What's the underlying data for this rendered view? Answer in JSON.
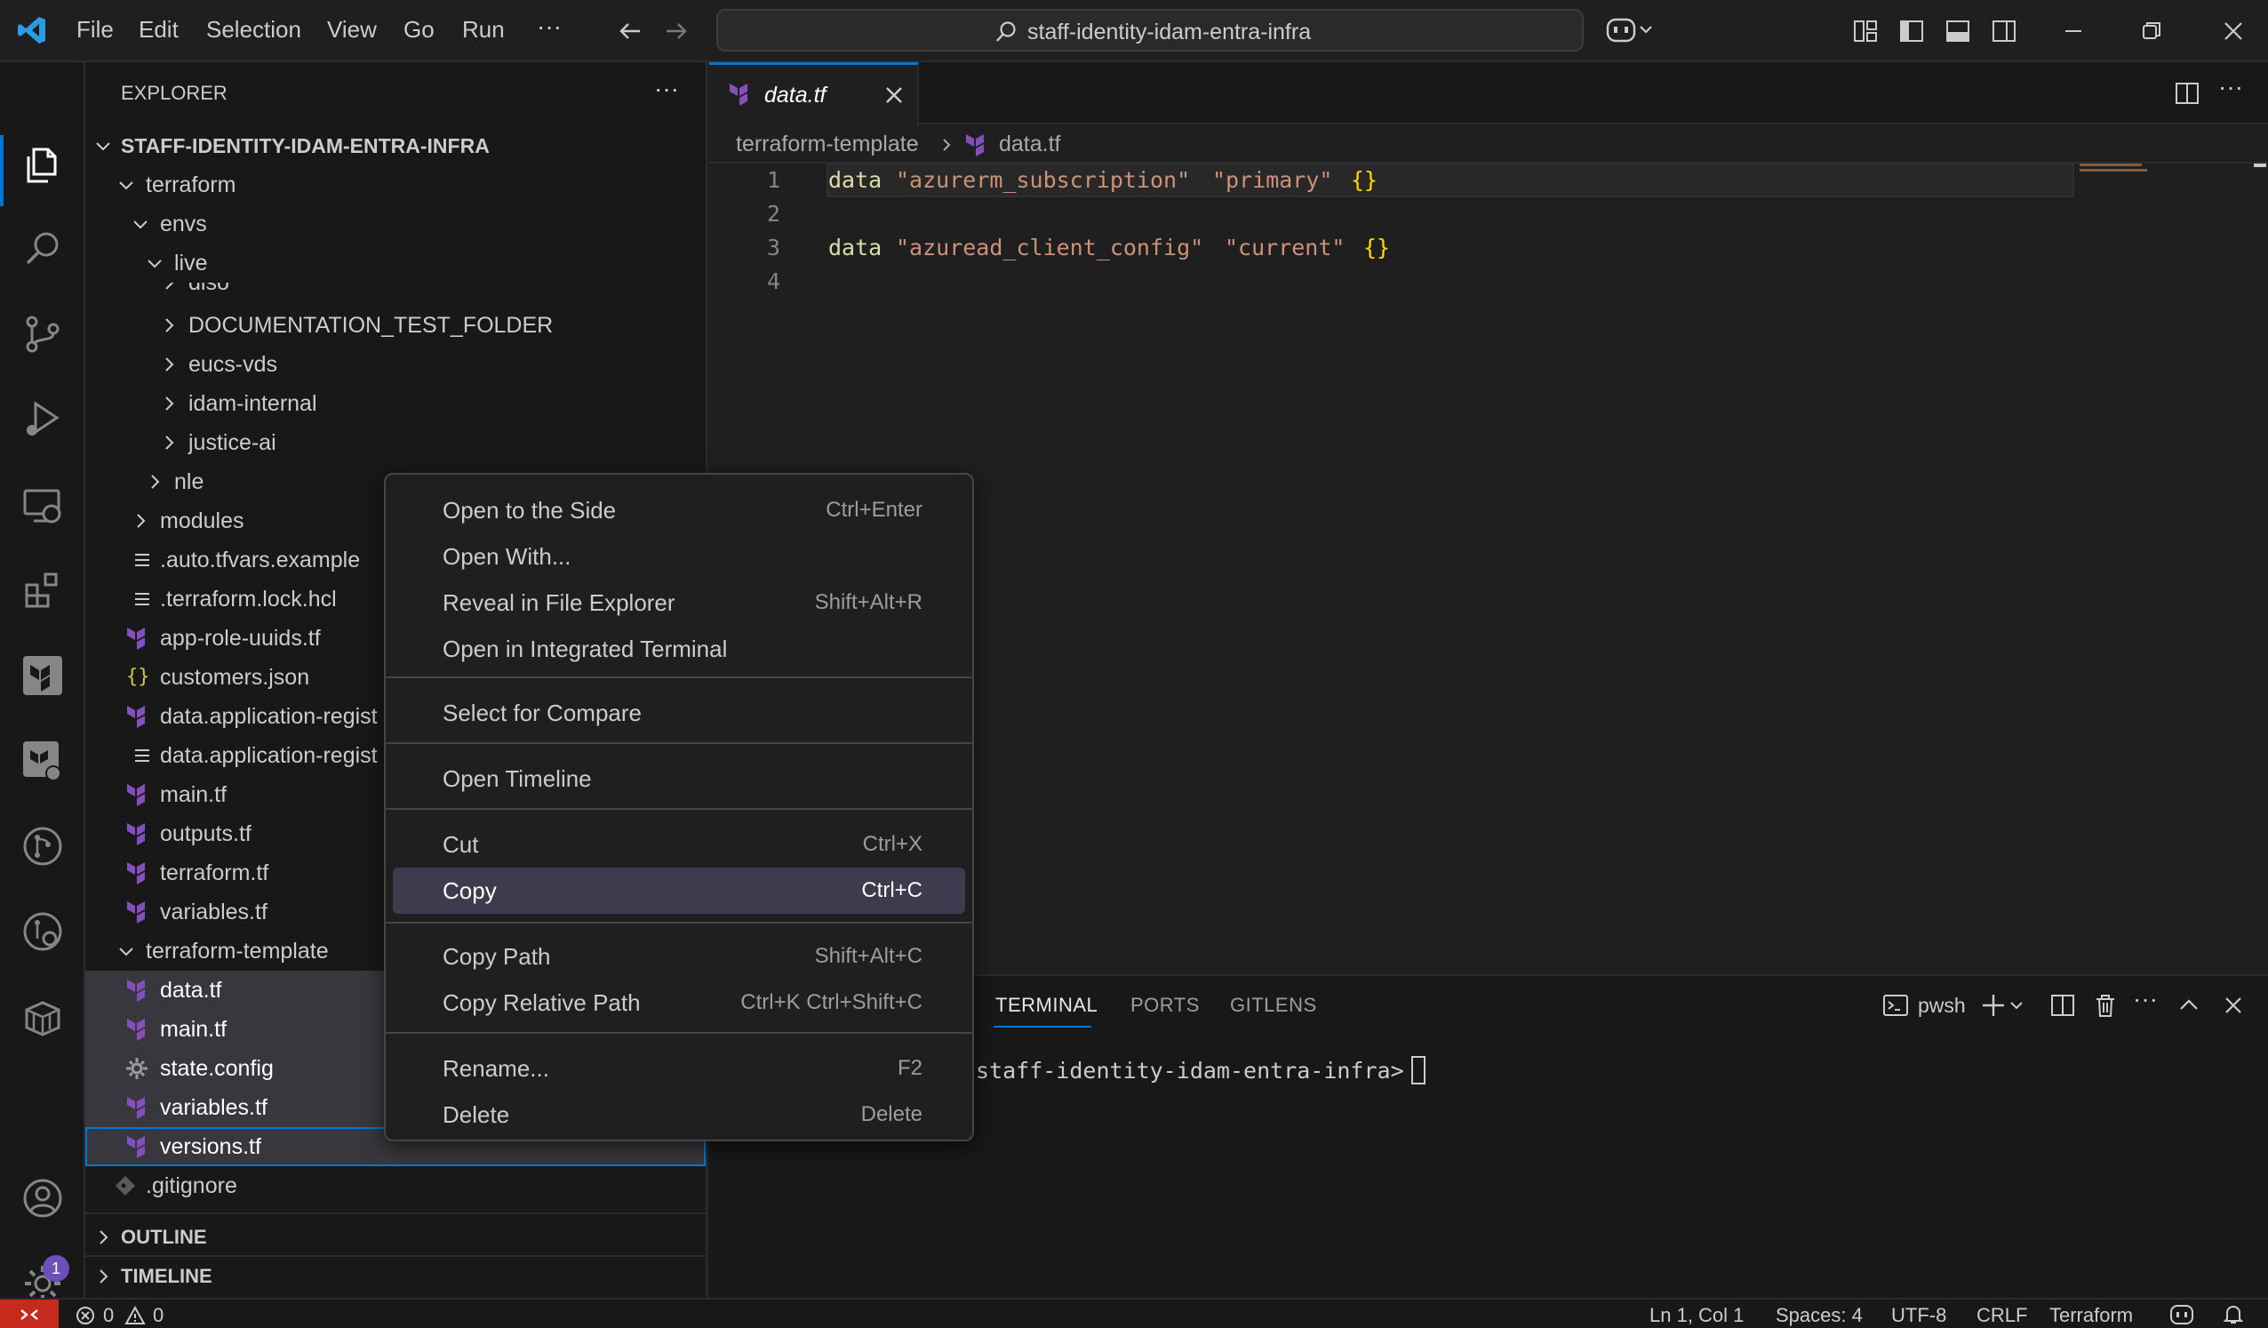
{
  "titlebar": {
    "menus": [
      "File",
      "Edit",
      "Selection",
      "View",
      "Go",
      "Run",
      "···"
    ],
    "search_text": "staff-identity-idam-entra-infra"
  },
  "sidebar": {
    "header": "EXPLORER",
    "more": "···",
    "root": "STAFF-IDENTITY-IDAM-ENTRA-INFRA",
    "tree": {
      "terraform": "terraform",
      "envs": "envs",
      "live": "live",
      "diso": "diso",
      "doc_test": "DOCUMENTATION_TEST_FOLDER",
      "eucs": "eucs-vds",
      "idam_internal": "idam-internal",
      "justice_ai": "justice-ai",
      "nle": "nle",
      "modules": "modules",
      "auto_tfvars": ".auto.tfvars.example",
      "lock": ".terraform.lock.hcl",
      "app_role": "app-role-uuids.tf",
      "customers": "customers.json",
      "data_app_1": "data.application-regist",
      "data_app_2": "data.application-regist",
      "main": "main.tf",
      "outputs": "outputs.tf",
      "terraform_tf": "terraform.tf",
      "variables": "variables.tf",
      "template": "terraform-template",
      "t_data": "data.tf",
      "t_main": "main.tf",
      "t_state": "state.config",
      "t_variables": "variables.tf",
      "t_versions": "versions.tf",
      "gitignore": ".gitignore"
    },
    "outline": "OUTLINE",
    "timeline": "TIMELINE"
  },
  "editor": {
    "tab_label": "data.tf",
    "breadcrumb_folder": "terraform-template",
    "breadcrumb_file": "data.tf",
    "lines": [
      {
        "num": "1",
        "kw": "data",
        "s1": "\"azurerm_subscription\"",
        "s2": "\"primary\"",
        "br": "{}"
      },
      {
        "num": "2"
      },
      {
        "num": "3",
        "kw": "data",
        "s1": "\"azuread_client_config\"",
        "s2": "\"current\"",
        "br": "{}"
      },
      {
        "num": "4"
      }
    ]
  },
  "panel": {
    "tabs": [
      "TERMINAL",
      "PORTS",
      "GITLENS"
    ],
    "shell": "pwsh",
    "prompt": "staff-identity-idam-entra-infra>"
  },
  "context_menu": {
    "items": [
      {
        "label": "Open to the Side",
        "key": "Ctrl+Enter"
      },
      {
        "label": "Open With...",
        "key": ""
      },
      {
        "label": "Reveal in File Explorer",
        "key": "Shift+Alt+R"
      },
      {
        "label": "Open in Integrated Terminal",
        "key": ""
      },
      {
        "label": "Select for Compare",
        "key": ""
      },
      {
        "label": "Open Timeline",
        "key": ""
      },
      {
        "label": "Cut",
        "key": "Ctrl+X"
      },
      {
        "label": "Copy",
        "key": "Ctrl+C"
      },
      {
        "label": "Copy Path",
        "key": "Shift+Alt+C"
      },
      {
        "label": "Copy Relative Path",
        "key": "Ctrl+K Ctrl+Shift+C"
      },
      {
        "label": "Rename...",
        "key": "F2"
      },
      {
        "label": "Delete",
        "key": "Delete"
      }
    ]
  },
  "statusbar": {
    "errors": "0",
    "warnings": "0",
    "position": "Ln 1, Col 1",
    "spaces": "Spaces: 4",
    "encoding": "UTF-8",
    "eol": "CRLF",
    "language": "Terraform",
    "settings_badge": "1"
  },
  "colors": {
    "accent": "#0078d4",
    "terraform": "#844fba",
    "selection": "#37373d",
    "remote": "#c42b1c"
  }
}
